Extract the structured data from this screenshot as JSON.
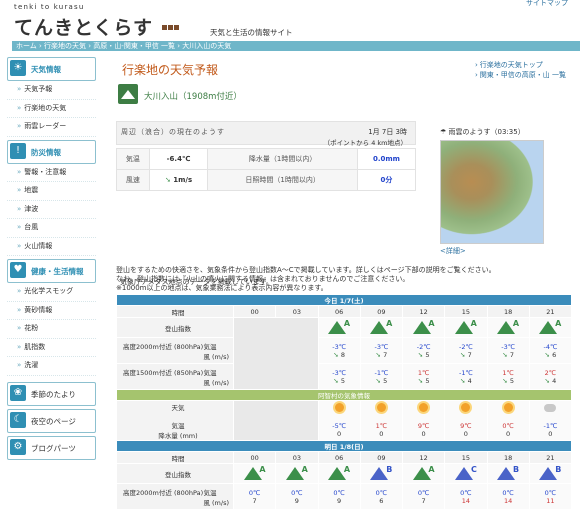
{
  "header": {
    "logo_sub": "tenki to kurasu",
    "logo": "てんきとくらす",
    "tagline": "天気と生活の情報サイト",
    "top_link": "サイトマップ"
  },
  "breadcrumb": "ホーム › 行楽地の天気 › 高原・山-関東・甲信 一覧 › 大川入山の天気",
  "sidebar": {
    "weather": {
      "label": "天気情報",
      "items": [
        "天気予報",
        "行楽地の天気",
        "雨雲レーダー"
      ]
    },
    "disaster": {
      "label": "防災情報",
      "items": [
        "警報・注意報",
        "地震",
        "津波",
        "台風",
        "火山情報"
      ]
    },
    "health": {
      "label": "健康・生活情報",
      "items": [
        "光化学スモッグ",
        "黄砂情報",
        "花粉",
        "肌指数",
        "洗濯"
      ]
    },
    "season": {
      "label": "季節のたより"
    },
    "night": {
      "label": "夜空のページ"
    },
    "blog": {
      "label": "ブログパーツ"
    }
  },
  "main": {
    "title": "行楽地の天気予報",
    "nav1": "行楽地の天気トップ",
    "nav2": "関東・甲信の高原・山 一覧",
    "place": "大川入山（1908m付近）",
    "current": {
      "title": "周辺（浪合）の現在のようす",
      "date": "1月 7日 3時",
      "point": "（ポイントから 4 km地点）",
      "temp_label": "気温",
      "temp": "-6.4℃",
      "rain_label": "降水量（1時間以内）",
      "rain": "0.0mm",
      "wind_label": "風速",
      "wind": "1m/s",
      "sun_label": "日照時間（1時間以内）",
      "sun": "0分"
    },
    "note1": "気象庁アメダス地点のデータを掲載しています。",
    "radar": {
      "title": "雨雲のようす（03:35）",
      "detail": "<詳細>"
    },
    "desc": [
      "登山をするための快適さを、気象条件から登山指数A～Cで掲載しています。詳しくはページ下部の説明をご覧ください。",
      "なお、登山指数には『火山の噴火に関する情報』は含まれておりませんのでご注意ください。",
      "※1000m以上の地点は、気象業務法により表示内容が異なります。"
    ]
  },
  "forecast": {
    "today": "今日 1/7(土)",
    "tomorrow": "明日 1/8(日)",
    "time_label": "時間",
    "hours": [
      "00",
      "03",
      "06",
      "09",
      "12",
      "15",
      "18",
      "21"
    ],
    "index_label": "登山指数",
    "hp800": "高度2000m付近 (800hPa)",
    "hp850": "高度1500m付近 (850hPa)",
    "temp_label": "気温",
    "wind_label": "風 (m/s)",
    "village": "阿智村の気象情報",
    "weather_label": "天気",
    "rain_label": "降水量 (mm)",
    "today_index": [
      "A",
      "A",
      "A",
      "A",
      "A",
      "A"
    ],
    "today_t800": [
      "-3℃",
      "-3℃",
      "-2℃",
      "-2℃",
      "-3℃",
      "-4℃"
    ],
    "today_w800": [
      "8",
      "7",
      "5",
      "7",
      "7",
      "6"
    ],
    "today_t850": [
      "-3℃",
      "-1℃",
      "1℃",
      "-1℃",
      "1℃",
      "2℃"
    ],
    "today_w850": [
      "5",
      "5",
      "5",
      "4",
      "5",
      "4"
    ],
    "today_vt": [
      "-5℃",
      "1℃",
      "9℃",
      "9℃",
      "0℃",
      "-1℃"
    ],
    "today_rain": [
      "0",
      "0",
      "0",
      "0",
      "0",
      "0"
    ],
    "tom_index": [
      "A",
      "A",
      "A",
      "B",
      "A",
      "C",
      "B",
      "B"
    ],
    "tom_t800": [
      "0℃",
      "0℃",
      "0℃",
      "0℃",
      "0℃",
      "0℃",
      "0℃",
      "0℃"
    ],
    "tom_w800": [
      "7",
      "9",
      "9",
      "6",
      "7",
      "14",
      "14",
      "11"
    ]
  }
}
